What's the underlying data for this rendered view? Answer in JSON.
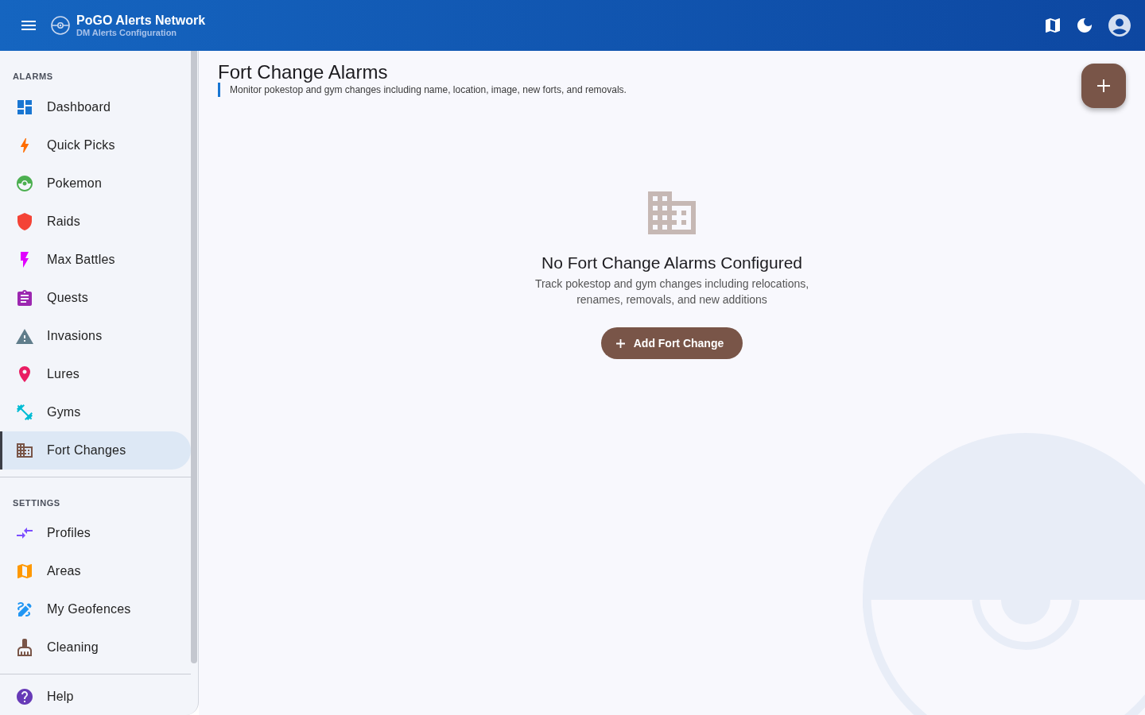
{
  "app_bar": {
    "title": "PoGO Alerts Network",
    "subtitle": "DM Alerts Configuration"
  },
  "sidebar": {
    "sections": [
      {
        "heading": "ALARMS",
        "items": [
          {
            "label": "Dashboard",
            "color": "#1976d2",
            "selected": false
          },
          {
            "label": "Quick Picks",
            "color": "#ff6d00",
            "selected": false
          },
          {
            "label": "Pokemon",
            "color": "#4caf50",
            "selected": false
          },
          {
            "label": "Raids",
            "color": "#f44336",
            "selected": false
          },
          {
            "label": "Max Battles",
            "color": "#e100ff",
            "selected": false
          },
          {
            "label": "Quests",
            "color": "#9c27b0",
            "selected": false
          },
          {
            "label": "Invasions",
            "color": "#607d8b",
            "selected": false
          },
          {
            "label": "Lures",
            "color": "#e91e63",
            "selected": false
          },
          {
            "label": "Gyms",
            "color": "#00bcd4",
            "selected": false
          },
          {
            "label": "Fort Changes",
            "color": "#795548",
            "selected": true
          }
        ]
      },
      {
        "heading": "SETTINGS",
        "items": [
          {
            "label": "Profiles",
            "color": "#7c4dff",
            "selected": false
          },
          {
            "label": "Areas",
            "color": "#ff9800",
            "selected": false
          },
          {
            "label": "My Geofences",
            "color": "#2196f3",
            "selected": false
          },
          {
            "label": "Cleaning",
            "color": "#795548",
            "selected": false
          }
        ]
      }
    ],
    "footer_items": [
      {
        "label": "Help",
        "color": "#673ab7",
        "selected": false
      }
    ]
  },
  "page": {
    "title": "Fort Change Alarms",
    "description": "Monitor pokestop and gym changes including name, location, image, new forts, and removals."
  },
  "empty_state": {
    "title": "No Fort Change Alarms Configured",
    "message": "Track pokestop and gym changes including relocations, renames, removals, and new additions",
    "button": "Add Fort Change"
  }
}
